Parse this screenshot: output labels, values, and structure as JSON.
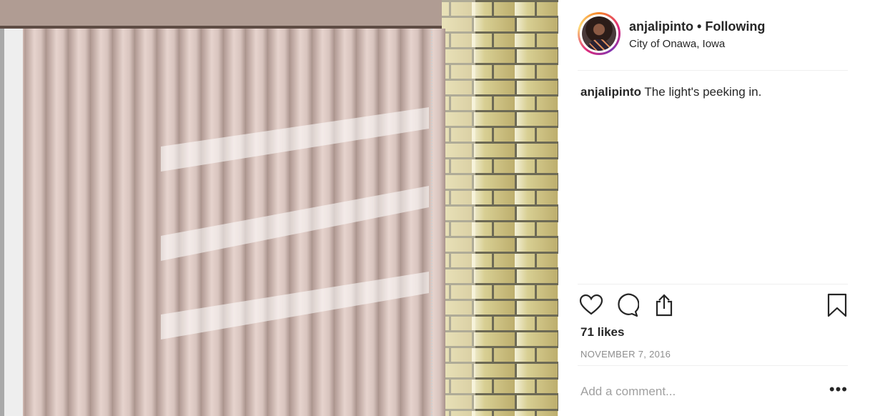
{
  "post": {
    "username": "anjalipinto",
    "separator": "•",
    "follow_status": "Following",
    "location": "City of Onawa, Iowa",
    "caption_user": "anjalipinto",
    "caption_text": "The light's peeking in.",
    "likes": "71 likes",
    "date": "NOVEMBER 7, 2016"
  },
  "comment": {
    "placeholder": "Add a comment..."
  },
  "more_label": "•••",
  "icons": [
    "heart-icon",
    "comment-icon",
    "share-icon",
    "bookmark-icon"
  ],
  "colors": {
    "accent_ring": "#dd2a7b",
    "text": "#262626",
    "muted": "#8e8e8e",
    "divider": "#efefef"
  }
}
